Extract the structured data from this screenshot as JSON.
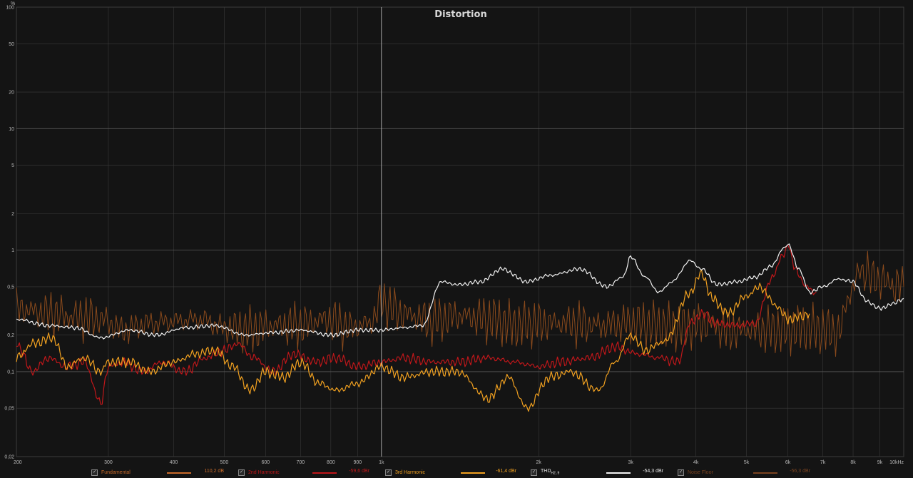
{
  "chart_data": {
    "type": "line",
    "title": "Distortion",
    "y_unit_label": "%",
    "x_scale": "log",
    "y_scale": "log",
    "xlim": [
      200,
      10000
    ],
    "ylim": [
      0.02,
      100
    ],
    "grid": true,
    "cursor_x": 1000,
    "x_ticks": [
      {
        "v": 200,
        "label": "200"
      },
      {
        "v": 300,
        "label": "300"
      },
      {
        "v": 400,
        "label": "400"
      },
      {
        "v": 500,
        "label": "500"
      },
      {
        "v": 600,
        "label": "600"
      },
      {
        "v": 700,
        "label": "700"
      },
      {
        "v": 800,
        "label": "800"
      },
      {
        "v": 900,
        "label": "900"
      },
      {
        "v": 1000,
        "label": "1k"
      },
      {
        "v": 2000,
        "label": "2k"
      },
      {
        "v": 3000,
        "label": "3k"
      },
      {
        "v": 4000,
        "label": "4k"
      },
      {
        "v": 5000,
        "label": "5k"
      },
      {
        "v": 6000,
        "label": "6k"
      },
      {
        "v": 7000,
        "label": "7k"
      },
      {
        "v": 8000,
        "label": "8k"
      },
      {
        "v": 9000,
        "label": "9k"
      },
      {
        "v": 10000,
        "label": "10kHz"
      }
    ],
    "y_ticks": [
      {
        "v": 100,
        "label": "100"
      },
      {
        "v": 50,
        "label": "50"
      },
      {
        "v": 20,
        "label": "20"
      },
      {
        "v": 10,
        "label": "10"
      },
      {
        "v": 5,
        "label": "5"
      },
      {
        "v": 2,
        "label": "2"
      },
      {
        "v": 1,
        "label": "1"
      },
      {
        "v": 0.5,
        "label": "0,5"
      },
      {
        "v": 0.2,
        "label": "0,2"
      },
      {
        "v": 0.1,
        "label": "0,1"
      },
      {
        "v": 0.05,
        "label": "0,05"
      },
      {
        "v": 0.02,
        "label": "0,02"
      }
    ],
    "series": [
      {
        "name": "Noise Floor",
        "color": "#8a4a1c",
        "width": 1.0,
        "wiggle": 0.22,
        "x": [
          200,
          230,
          260,
          290,
          320,
          360,
          400,
          450,
          500,
          560,
          620,
          700,
          780,
          870,
          950,
          1000,
          1100,
          1250,
          1400,
          1600,
          1800,
          2000,
          2300,
          2600,
          3000,
          3400,
          3800,
          4200,
          4600,
          5000,
          5500,
          6000,
          6500,
          7000,
          7500,
          7900,
          8300,
          8700,
          9200,
          9700,
          10000
        ],
        "y": [
          0.33,
          0.3,
          0.28,
          0.27,
          0.22,
          0.25,
          0.26,
          0.27,
          0.23,
          0.22,
          0.24,
          0.24,
          0.27,
          0.23,
          0.25,
          0.37,
          0.3,
          0.26,
          0.29,
          0.27,
          0.24,
          0.25,
          0.25,
          0.24,
          0.25,
          0.24,
          0.23,
          0.25,
          0.22,
          0.22,
          0.22,
          0.22,
          0.23,
          0.22,
          0.21,
          0.45,
          0.7,
          0.6,
          0.55,
          0.5,
          0.5
        ]
      },
      {
        "name": "2nd Harmonic",
        "color": "#c0171a",
        "width": 1.2,
        "wiggle": 0.05,
        "x": [
          200,
          215,
          230,
          250,
          270,
          290,
          300,
          320,
          350,
          380,
          420,
          460,
          500,
          530,
          570,
          620,
          680,
          750,
          820,
          900,
          1000,
          1100,
          1250,
          1400,
          1600,
          1800,
          2000,
          2200,
          2500,
          2800,
          3100,
          3400,
          3700,
          3900,
          4100,
          4400,
          4800,
          5200,
          5600,
          5900,
          6000,
          6200,
          6500,
          6800
        ],
        "y": [
          0.17,
          0.1,
          0.13,
          0.11,
          0.12,
          0.055,
          0.11,
          0.12,
          0.1,
          0.12,
          0.1,
          0.13,
          0.15,
          0.17,
          0.13,
          0.1,
          0.14,
          0.12,
          0.13,
          0.11,
          0.12,
          0.13,
          0.12,
          0.12,
          0.13,
          0.12,
          0.11,
          0.12,
          0.13,
          0.16,
          0.14,
          0.13,
          0.12,
          0.25,
          0.3,
          0.25,
          0.24,
          0.25,
          0.6,
          0.95,
          1.1,
          0.7,
          0.5,
          0.45
        ]
      },
      {
        "name": "3rd Harmonic",
        "color": "#f0a020",
        "width": 1.2,
        "wiggle": 0.05,
        "x": [
          200,
          215,
          235,
          250,
          270,
          290,
          300,
          330,
          360,
          400,
          440,
          480,
          520,
          560,
          600,
          650,
          700,
          760,
          820,
          900,
          1000,
          1100,
          1250,
          1400,
          1600,
          1750,
          1900,
          2100,
          2300,
          2600,
          2800,
          3000,
          3200,
          3500,
          3900,
          4100,
          4300,
          4600,
          5000,
          5300,
          5700,
          6000,
          6300,
          6600
        ],
        "y": [
          0.13,
          0.17,
          0.19,
          0.11,
          0.13,
          0.1,
          0.12,
          0.12,
          0.1,
          0.12,
          0.14,
          0.15,
          0.11,
          0.07,
          0.1,
          0.09,
          0.12,
          0.08,
          0.07,
          0.08,
          0.11,
          0.09,
          0.1,
          0.1,
          0.06,
          0.09,
          0.05,
          0.09,
          0.1,
          0.07,
          0.12,
          0.2,
          0.15,
          0.18,
          0.45,
          0.65,
          0.4,
          0.3,
          0.42,
          0.5,
          0.35,
          0.27,
          0.28,
          0.3
        ]
      },
      {
        "name": "THD",
        "color": "#f2f2f2",
        "width": 1.2,
        "wiggle": 0.02,
        "x": [
          200,
          230,
          260,
          290,
          330,
          370,
          420,
          480,
          550,
          620,
          700,
          800,
          900,
          1000,
          1100,
          1200,
          1300,
          1400,
          1550,
          1700,
          1900,
          2100,
          2400,
          2700,
          2900,
          3000,
          3200,
          3400,
          3600,
          3900,
          4100,
          4400,
          4800,
          5200,
          5600,
          5900,
          6000,
          6300,
          6600,
          7000,
          7500,
          8000,
          8500,
          9000,
          9500,
          10000
        ],
        "y": [
          0.27,
          0.24,
          0.23,
          0.19,
          0.22,
          0.2,
          0.23,
          0.24,
          0.2,
          0.21,
          0.22,
          0.2,
          0.22,
          0.22,
          0.23,
          0.24,
          0.55,
          0.52,
          0.55,
          0.7,
          0.55,
          0.62,
          0.7,
          0.5,
          0.6,
          0.88,
          0.6,
          0.45,
          0.55,
          0.82,
          0.7,
          0.52,
          0.55,
          0.6,
          0.75,
          1.05,
          1.12,
          0.7,
          0.45,
          0.5,
          0.58,
          0.55,
          0.38,
          0.33,
          0.36,
          0.4
        ]
      }
    ]
  },
  "legend": {
    "items": [
      {
        "label": "Fundamental",
        "value": "110,2 dB",
        "color": "#c76a2a",
        "checked": "✓"
      },
      {
        "label": "2nd Harmonic",
        "value": "-59,6 dBr",
        "color": "#c0171a",
        "checked": "✓"
      },
      {
        "label": "3rd Harmonic",
        "value": "-61,4 dBr",
        "color": "#f0a020",
        "checked": "✓"
      },
      {
        "label": "THD",
        "sub": "H2..9",
        "value": "-54,3 dBr",
        "color": "#f2f2f2",
        "checked": "✓"
      },
      {
        "label": "Noise Floor",
        "value": "-56,3 dBr",
        "color": "#7a4320",
        "checked": "✓"
      }
    ]
  }
}
